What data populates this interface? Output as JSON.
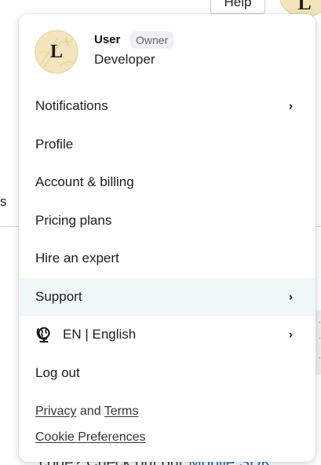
{
  "background": {
    "help_label": "Help",
    "avatar_letter": "L",
    "partial_text": "s",
    "bottom_text": "code? Check out our",
    "bottom_link": "Mobile SDK"
  },
  "user": {
    "avatar_letter": "L",
    "name": "User",
    "badge": "Owner",
    "role": "Developer"
  },
  "menu": {
    "notifications": "Notifications",
    "profile": "Profile",
    "account_billing": "Account & billing",
    "pricing_plans": "Pricing plans",
    "hire_expert": "Hire an expert",
    "support": "Support",
    "language": "EN | English",
    "log_out": "Log out",
    "chevron": "›"
  },
  "legal": {
    "privacy": "Privacy",
    "and": "and",
    "terms": "Terms",
    "cookie": "Cookie Preferences"
  },
  "colors": {
    "active_row": "#f0f7f9",
    "avatar_bg": "#f3e6bd",
    "badge_bg": "#f0f0f2",
    "link_blue": "#2b6cb0"
  },
  "icons": {
    "language": "globe-icon",
    "submenu": "chevron-right-icon"
  }
}
